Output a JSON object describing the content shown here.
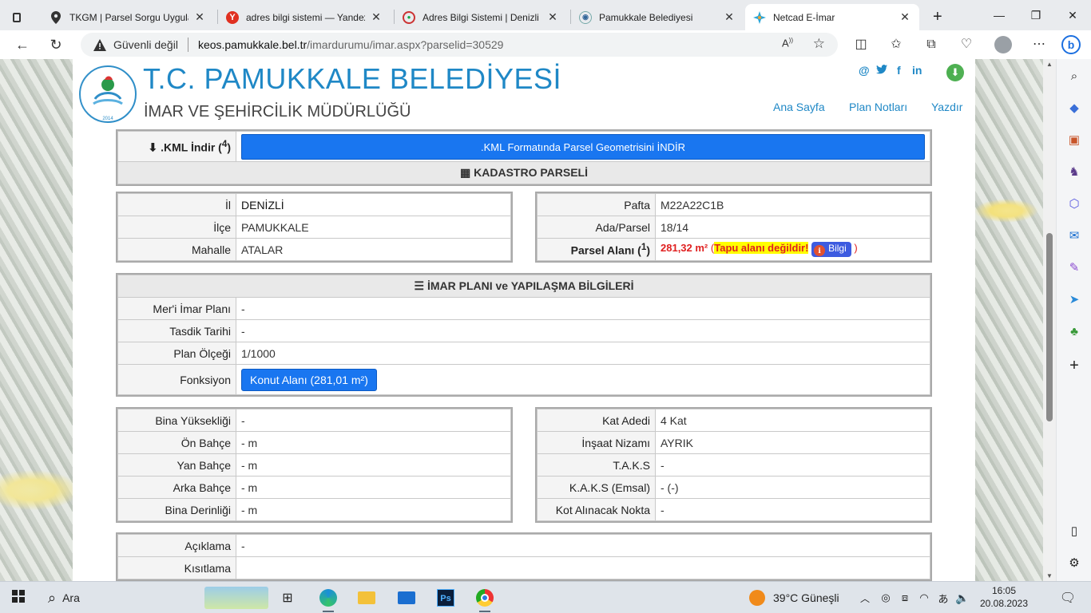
{
  "browser": {
    "tabs": [
      {
        "title": "TKGM | Parsel Sorgu Uygulam",
        "icon": "location-pin-icon"
      },
      {
        "title": "adres bilgi sistemi — Yandex",
        "icon": "yandex-icon"
      },
      {
        "title": "Adres Bilgi Sistemi | Denizli B",
        "icon": "site-logo-icon"
      },
      {
        "title": "Pamukkale Belediyesi",
        "icon": "municipality-icon"
      },
      {
        "title": "Netcad E-İmar",
        "icon": "netcad-icon"
      }
    ],
    "not_secure_label": "Güvenli değil",
    "url_host": "keos.pamukkale.bel.tr",
    "url_path": "/imardurumu/imar.aspx?parselid=30529"
  },
  "header": {
    "title": "T.C. PAMUKKALE BELEDİYESİ",
    "subtitle": "İMAR VE ŞEHİRCİLİK MÜDÜRLÜĞÜ",
    "logo_text": "PAMUKKALE BELEDİYESİ",
    "nav": {
      "home": "Ana Sayfa",
      "plan_notes": "Plan Notları",
      "print": "Yazdır"
    },
    "social": {
      "at": "@",
      "twitter": "🐦",
      "facebook": "f",
      "linkedin": "in"
    }
  },
  "kml": {
    "label": ".KML İndir",
    "note_sup": "4",
    "button": ".KML Formatında Parsel Geometrisini İNDİR"
  },
  "kadastro": {
    "title": "KADASTRO PARSELİ",
    "left": [
      {
        "label": "İl",
        "value": "DENİZLİ"
      },
      {
        "label": "İlçe",
        "value": "PAMUKKALE"
      },
      {
        "label": "Mahalle",
        "value": "ATALAR"
      }
    ],
    "right": [
      {
        "label": "Pafta",
        "value": "M22A22C1B"
      },
      {
        "label": "Ada/Parsel",
        "value": "18/14"
      }
    ],
    "area_label": "Parsel Alanı",
    "area_sup": "1",
    "area_value": "281,32 m²",
    "area_warning": "Tapu alanı değildir!",
    "info_button": "Bilgi"
  },
  "imar": {
    "title": "İMAR PLANI ve YAPILAŞMA BİLGİLERİ",
    "rows": [
      {
        "label": "Mer'i İmar Planı",
        "value": "-"
      },
      {
        "label": "Tasdik Tarihi",
        "value": "-"
      },
      {
        "label": "Plan Ölçeği",
        "value": "1/1000"
      }
    ],
    "function_label": "Fonksiyon",
    "function_button": "Konut Alanı (281,01 m²)"
  },
  "building_left": [
    {
      "label": "Bina Yüksekliği",
      "value": "-"
    },
    {
      "label": "Ön Bahçe",
      "value": "- m"
    },
    {
      "label": "Yan Bahçe",
      "value": "- m"
    },
    {
      "label": "Arka Bahçe",
      "value": "- m"
    },
    {
      "label": "Bina Derinliği",
      "value": "- m"
    }
  ],
  "building_right": [
    {
      "label": "Kat Adedi",
      "value": "4 Kat"
    },
    {
      "label": "İnşaat Nizamı",
      "value": "AYRIK"
    },
    {
      "label": "T.A.K.S",
      "value": "-"
    },
    {
      "label": "K.A.K.S (Emsal)",
      "value": "- (-)"
    },
    {
      "label": "Kot Alınacak Nokta",
      "value": "-"
    }
  ],
  "notes": [
    {
      "label": "Açıklama",
      "value": "-"
    },
    {
      "label": "Kısıtlama",
      "value": ""
    }
  ],
  "taskbar": {
    "search_label": "Ara",
    "weather": "39°C  Güneşli",
    "time": "16:05",
    "date": "20.08.2023"
  },
  "colors": {
    "brand": "#1f88c6",
    "button": "#1976f0",
    "alert": "#e02020",
    "highlight": "#ffff00"
  }
}
